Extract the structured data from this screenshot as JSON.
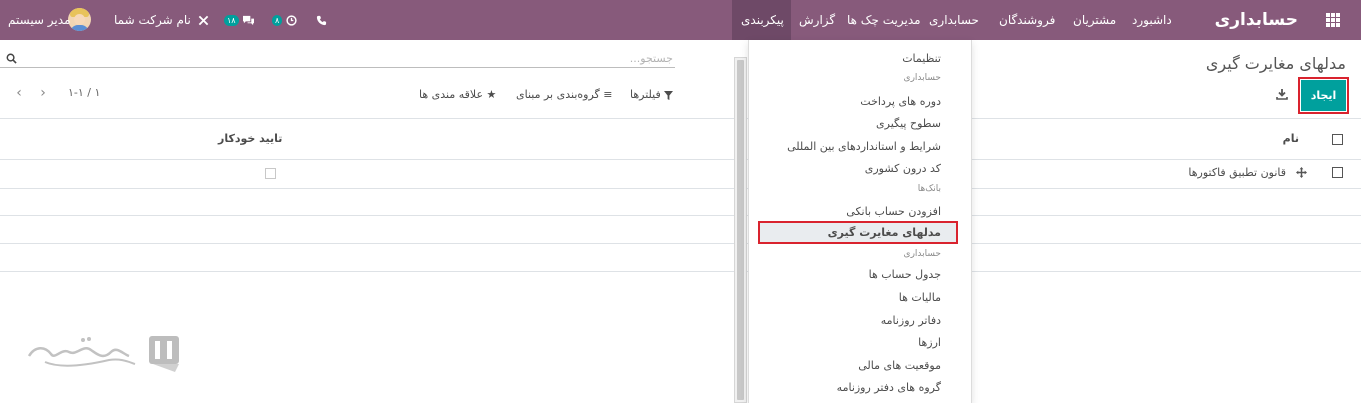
{
  "topbar": {
    "brand": "حسابداری",
    "menu": [
      {
        "label": "داشبورد"
      },
      {
        "label": "مشتریان"
      },
      {
        "label": "فروشندگان"
      },
      {
        "label": "حسابداری"
      },
      {
        "label": "مدیریت چک ها"
      },
      {
        "label": "گزارش"
      },
      {
        "label": "پیکربندی"
      }
    ],
    "company": "نام شرکت شما",
    "user": "مدیر سیستم",
    "chat_badge": "۱۸",
    "activity_badge": "۸",
    "colors": {
      "bar": "#875a7b",
      "active": "#6e4967",
      "badge": "#00a09d"
    }
  },
  "control_panel": {
    "title": "مدلهای مغایرت گیری",
    "create_label": "ایجاد",
    "search_placeholder": "جستجو...",
    "filters_label": "فیلترها",
    "group_by_label": "گروه‌بندی بر مبنای",
    "favorites_label": "علاقه مندی ها",
    "pager": "۱-۱ / ۱"
  },
  "table": {
    "columns": [
      "نام",
      "تایید خودکار"
    ],
    "rows": [
      {
        "name": "قانون تطبیق فاکتورها",
        "auto_validate": false
      }
    ]
  },
  "dropdown": {
    "items": [
      {
        "type": "item",
        "label": "تنظیمات"
      },
      {
        "type": "header",
        "label": "حسابداری"
      },
      {
        "type": "item",
        "label": "دوره های پرداخت"
      },
      {
        "type": "item",
        "label": "سطوح پیگیری"
      },
      {
        "type": "item",
        "label": "شرایط و استانداردهای بین المللی"
      },
      {
        "type": "item",
        "label": "کد درون کشوری"
      },
      {
        "type": "header",
        "label": "بانک‌ها"
      },
      {
        "type": "item",
        "label": "افزودن حساب بانکی"
      },
      {
        "type": "item",
        "label": "مدلهای مغایرت گیری",
        "selected": true
      },
      {
        "type": "header",
        "label": "حسابداری"
      },
      {
        "type": "item",
        "label": "جدول حساب ها"
      },
      {
        "type": "item",
        "label": "مالیات ها"
      },
      {
        "type": "item",
        "label": "دفاتر روزنامه"
      },
      {
        "type": "item",
        "label": "ارزها"
      },
      {
        "type": "item",
        "label": "موقعیت های مالی"
      },
      {
        "type": "item",
        "label": "گروه های دفتر روزنامه"
      }
    ]
  },
  "accent": {
    "create_button": "#00a09d",
    "highlight_outline": "#d9232e"
  }
}
